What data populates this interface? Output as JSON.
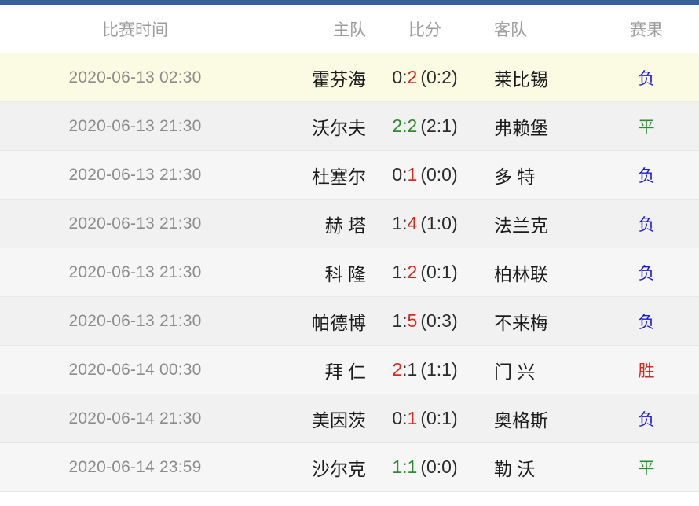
{
  "theme": {
    "accent_bar_color": "#37619b",
    "highlight_row_color": "#fbfbe4",
    "win_color": "#d9291c",
    "draw_color": "#2e8b34",
    "lose_color": "#1a1ad0"
  },
  "header": {
    "time": "比赛时间",
    "home": "主队",
    "score": "比分",
    "away": "客队",
    "result": "赛果"
  },
  "rows": [
    {
      "time": "2020-06-13 02:30",
      "home": "霍芬海",
      "score_a": "0:",
      "score_b": "2",
      "score_a_color": "sc-dark",
      "score_b_color": "sc-red",
      "halftime": "(0:2)",
      "away": "莱比锡",
      "result": "负",
      "result_class": "r-lose",
      "row_class": "bg-highlight"
    },
    {
      "time": "2020-06-13 21:30",
      "home": "沃尔夫",
      "score_a": "2:",
      "score_b": "2",
      "score_a_color": "sc-green",
      "score_b_color": "sc-green",
      "halftime": "(2:1)",
      "away": "弗赖堡",
      "result": "平",
      "result_class": "r-draw",
      "row_class": "bg-a"
    },
    {
      "time": "2020-06-13 21:30",
      "home": "杜塞尔",
      "score_a": "0:",
      "score_b": "1",
      "score_a_color": "sc-dark",
      "score_b_color": "sc-red",
      "halftime": "(0:0)",
      "away": "多 特",
      "result": "负",
      "result_class": "r-lose",
      "row_class": "bg-b"
    },
    {
      "time": "2020-06-13 21:30",
      "home": "赫 塔",
      "score_a": "1:",
      "score_b": "4",
      "score_a_color": "sc-dark",
      "score_b_color": "sc-red",
      "halftime": "(1:0)",
      "away": "法兰克",
      "result": "负",
      "result_class": "r-lose",
      "row_class": "bg-a"
    },
    {
      "time": "2020-06-13 21:30",
      "home": "科 隆",
      "score_a": "1:",
      "score_b": "2",
      "score_a_color": "sc-dark",
      "score_b_color": "sc-red",
      "halftime": "(0:1)",
      "away": "柏林联",
      "result": "负",
      "result_class": "r-lose",
      "row_class": "bg-b"
    },
    {
      "time": "2020-06-13 21:30",
      "home": "帕德博",
      "score_a": "1:",
      "score_b": "5",
      "score_a_color": "sc-dark",
      "score_b_color": "sc-red",
      "halftime": "(0:3)",
      "away": "不来梅",
      "result": "负",
      "result_class": "r-lose",
      "row_class": "bg-a"
    },
    {
      "time": "2020-06-14 00:30",
      "home": "拜 仁",
      "score_a": "2",
      "score_b": ":1",
      "score_a_color": "sc-red",
      "score_b_color": "sc-dark",
      "halftime": "(1:1)",
      "away": "门 兴",
      "result": "胜",
      "result_class": "r-win",
      "row_class": "bg-b"
    },
    {
      "time": "2020-06-14 21:30",
      "home": "美因茨",
      "score_a": "0:",
      "score_b": "1",
      "score_a_color": "sc-dark",
      "score_b_color": "sc-red",
      "halftime": "(0:1)",
      "away": "奥格斯",
      "result": "负",
      "result_class": "r-lose",
      "row_class": "bg-a"
    },
    {
      "time": "2020-06-14 23:59",
      "home": "沙尔克",
      "score_a": "1:",
      "score_b": "1",
      "score_a_color": "sc-green",
      "score_b_color": "sc-green",
      "halftime": "(0:0)",
      "away": "勒 沃",
      "result": "平",
      "result_class": "r-draw",
      "row_class": "bg-b"
    }
  ]
}
